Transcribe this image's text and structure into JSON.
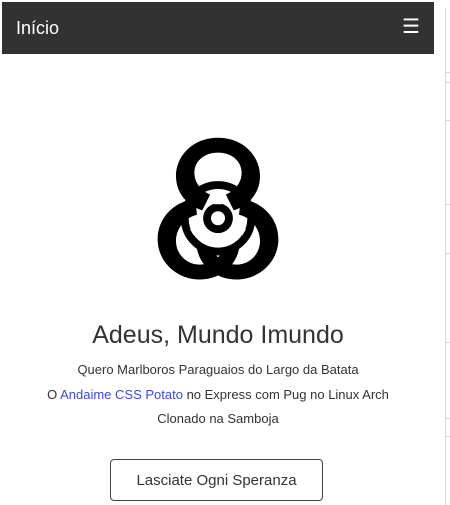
{
  "navbar": {
    "brand": "Início",
    "menu_icon": "hamburger-menu-icon",
    "menu_glyph": "☰",
    "background": "#323232"
  },
  "hero": {
    "logo_icon": "biohazard-icon",
    "title": "Adeus, Mundo Imundo",
    "line1": "Quero Marlboros Paraguaios do Largo da Batata",
    "line2_prefix": "O ",
    "line2_link": "Andaime CSS Potato",
    "line2_suffix": " no Express com Pug no Linux Arch",
    "line3": "Clonado na Samboja",
    "button_label": "Lasciate Ogni Speranza",
    "link_color": "#3b4bd6"
  }
}
